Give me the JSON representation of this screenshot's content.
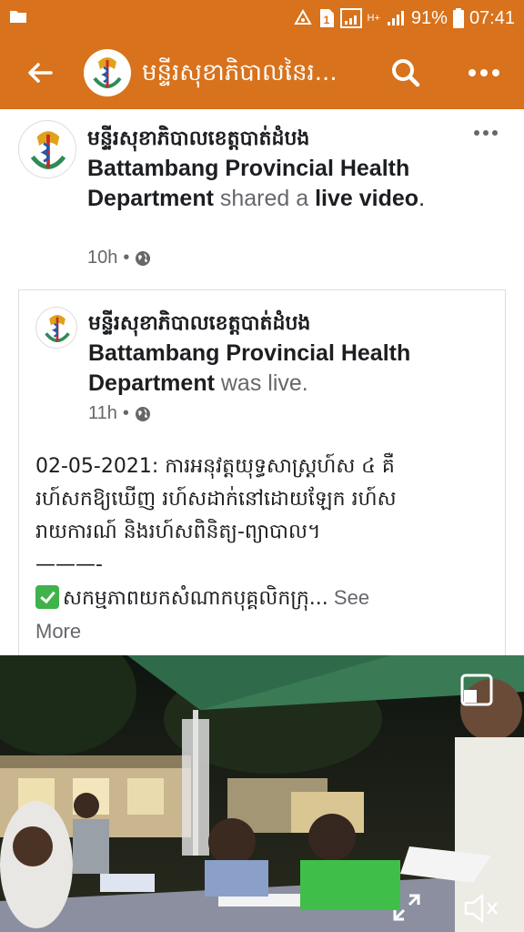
{
  "status_bar": {
    "battery_percent": "91%",
    "time": "07:41",
    "sim_slot": "1",
    "network": "H+"
  },
  "app_bar": {
    "title": "មន្ទីរសុខាភិបាលនៃរ...",
    "background_color": "#d8721c"
  },
  "post": {
    "page_name_khmer": "មន្ទីរសុខាភិបាលខេត្តបាត់ដំបង",
    "page_name_english": "Battambang Provincial Health Department",
    "action_text": " shared a ",
    "object_text": "live video",
    "trailing": ".",
    "time": "10h",
    "privacy_icon": "globe-icon"
  },
  "shared_card": {
    "page_name_khmer": "មន្ទីរសុខាភិបាលខេត្តបាត់ដំបង",
    "page_name_english": "Battambang Provincial Health Department",
    "status_text": " was live.",
    "time": "11h",
    "privacy_icon": "globe-icon",
    "body_line1": "02-05-2021: ការអនុវត្តយុទ្ធសាស្ត្រហ៍ស ៤ គឺ",
    "body_line2": "រហ៍សកឱ្យឃើញ រហ៍សដាក់នៅដោយឡែក រហ៍ស",
    "body_line3": "រាយការណ៍ និងរហ៍សពិនិត្យ-ព្យាបាល។",
    "body_line4": "———-",
    "body_line5": "សកម្មភាពយកសំណាកបុគ្គលិកក្រុ...",
    "see_more_1": " See",
    "see_more_2": "More"
  },
  "video": {
    "controls": [
      "picture-in-picture-icon",
      "fullscreen-icon",
      "mute-icon"
    ]
  }
}
